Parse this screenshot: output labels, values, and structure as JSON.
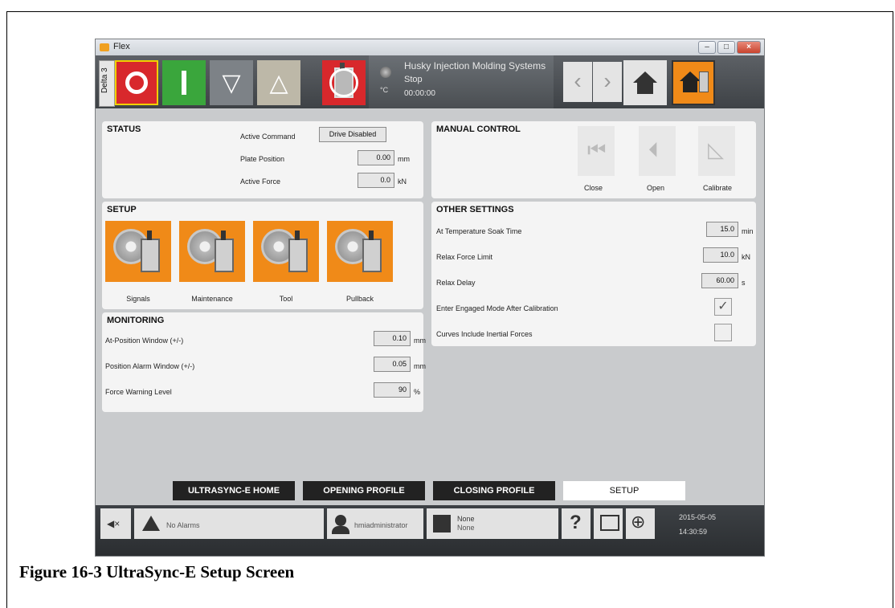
{
  "window": {
    "title": "Flex"
  },
  "toolbar": {
    "delta_label": "Delta 3",
    "stop_icon": "stop-icon",
    "start_icon": "start-icon",
    "close_arrow": "▽",
    "open_arrow": "△",
    "machine_line1": "Husky Injection Molding Systems",
    "machine_line2": "Stop",
    "machine_line3": "00:00:00",
    "temp_unit": "°C",
    "nav_back": "‹",
    "nav_forward": "›"
  },
  "status": {
    "title": "STATUS",
    "active_command_label": "Active Command",
    "active_command_value": "Drive Disabled",
    "plate_position_label": "Plate Position",
    "plate_position_value": "0.00",
    "plate_position_unit": "mm",
    "active_force_label": "Active Force",
    "active_force_value": "0.0",
    "active_force_unit": "kN"
  },
  "manual_control": {
    "title": "MANUAL CONTROL",
    "close_label": "Close",
    "open_label": "Open",
    "calibrate_label": "Calibrate"
  },
  "setup": {
    "title": "SETUP",
    "buttons": [
      "Signals",
      "Maintenance",
      "Tool",
      "Pullback"
    ]
  },
  "other_settings": {
    "title": "OTHER SETTINGS",
    "soak_label": "At Temperature Soak Time",
    "soak_value": "15.0",
    "soak_unit": "min",
    "relax_force_label": "Relax Force Limit",
    "relax_force_value": "10.0",
    "relax_force_unit": "kN",
    "relax_delay_label": "Relax Delay",
    "relax_delay_value": "60.00",
    "relax_delay_unit": "s",
    "engaged_label": "Enter Engaged Mode After Calibration",
    "engaged_checked": "✓",
    "curves_label": "Curves Include Inertial Forces"
  },
  "monitoring": {
    "title": "MONITORING",
    "at_position_label": "At-Position Window (+/-)",
    "at_position_value": "0.10",
    "at_position_unit": "mm",
    "pos_alarm_label": "Position Alarm Window (+/-)",
    "pos_alarm_value": "0.05",
    "pos_alarm_unit": "mm",
    "force_warn_label": "Force Warning Level",
    "force_warn_value": "90",
    "force_warn_unit": "%"
  },
  "tabs": [
    "ULTRASYNC-E HOME",
    "OPENING PROFILE",
    "CLOSING PROFILE",
    "SETUP"
  ],
  "bottom": {
    "mute_icon": "◀×",
    "alarms": "No Alarms",
    "user": "hmiadministrator",
    "mold_line1": "None",
    "mold_line2": "None",
    "help": "?",
    "date": "2015-05-05",
    "time": "14:30:59"
  },
  "caption": "Figure 16-3  UltraSync-E Setup Screen"
}
